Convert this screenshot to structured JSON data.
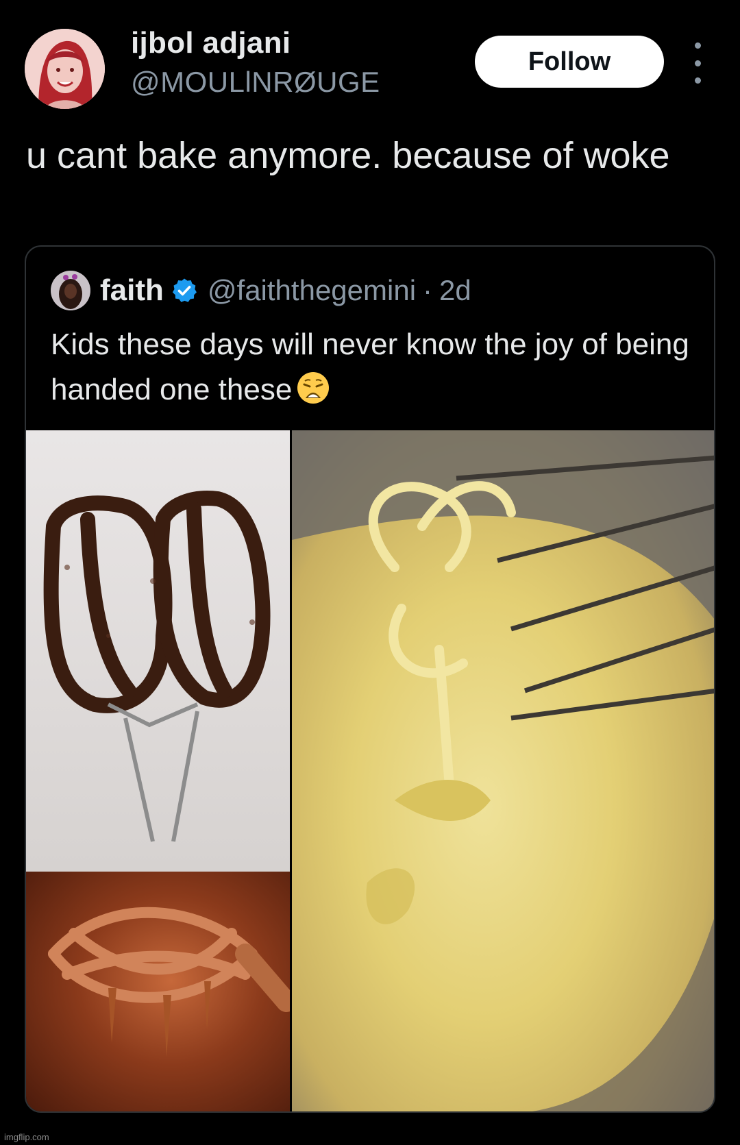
{
  "tweet": {
    "display_name": "ijbol adjani",
    "handle": "@MOULlNRØUGE",
    "follow_label": "Follow",
    "text": "u cant bake anymore. because of woke"
  },
  "quote": {
    "display_name": "faith",
    "handle": "@faiththegemini",
    "separator": "·",
    "time": "2d",
    "text": "Kids these days will never know the joy of being handed one these",
    "emoji": "weary-face"
  },
  "media": {
    "images": [
      "chocolate-covered mixer beaters",
      "whisk dipped in caramel",
      "whisk in yellow batter bowl"
    ]
  },
  "footer": {
    "watermark": "imgflip.com"
  },
  "colors": {
    "background": "#000000",
    "text": "#e7e9ea",
    "secondary": "#8b98a5",
    "verified": "#1d9bf0",
    "border": "#2f3336"
  }
}
